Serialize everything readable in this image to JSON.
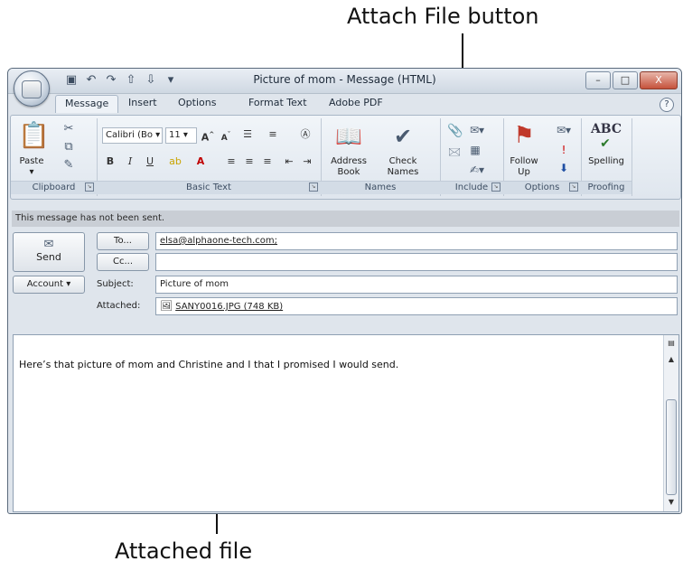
{
  "callouts": {
    "attach_file": "Attach File button",
    "attached_file": "Attached file"
  },
  "window": {
    "title": "Picture of mom - Message (HTML)",
    "controls": {
      "minimize": "–",
      "maximize": "□",
      "close": "X"
    }
  },
  "qat_icons": [
    "save-icon",
    "undo-icon",
    "redo-icon",
    "arrow-up-icon",
    "arrow-down-icon",
    "customize-icon"
  ],
  "tabs": [
    "Message",
    "Insert",
    "Options",
    "Format Text",
    "Adobe PDF"
  ],
  "active_tab": "Message",
  "ribbon": {
    "clipboard": {
      "label": "Clipboard",
      "paste": "Paste"
    },
    "basic_text": {
      "label": "Basic Text",
      "font": "Calibri (Bo",
      "size": "11",
      "bold": "B",
      "italic": "I",
      "underline": "U"
    },
    "names": {
      "label": "Names",
      "address_book": "Address Book",
      "check_names": "Check Names"
    },
    "include": {
      "label": "Include"
    },
    "options": {
      "label": "Options",
      "follow_up": "Follow Up"
    },
    "proofing": {
      "label": "Proofing",
      "spelling": "Spelling",
      "abc": "ABC"
    }
  },
  "message": {
    "info_bar": "This message has not been sent.",
    "send_label": "Send",
    "to_label": "To...",
    "cc_label": "Cc...",
    "account_label": "Account",
    "subject_label": "Subject:",
    "attached_label": "Attached:",
    "to_value": "elsa@alphaone-tech.com;",
    "cc_value": "",
    "subject_value": "Picture of mom",
    "attachment": "SANY0016.JPG (748 KB)",
    "body": "Here’s that picture of mom and Christine and I that I promised I would send."
  }
}
